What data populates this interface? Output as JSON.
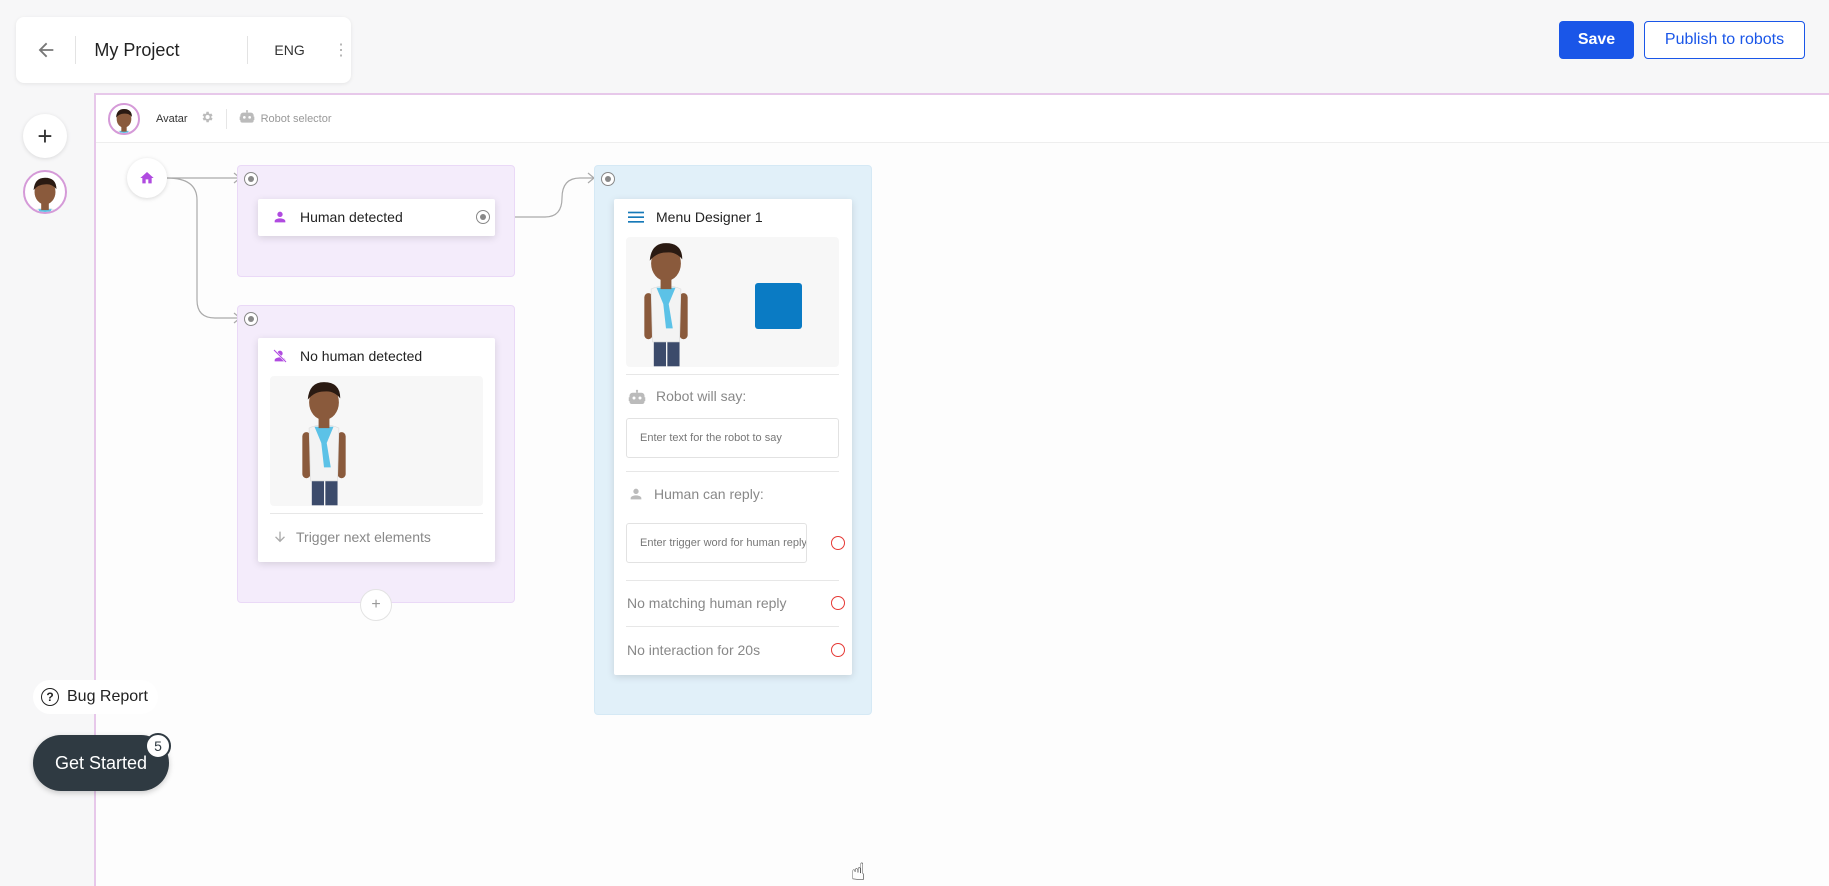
{
  "header": {
    "project_title": "My Project",
    "language": "ENG",
    "save_label": "Save",
    "publish_label": "Publish to robots"
  },
  "canvas_bar": {
    "avatar_label": "Avatar",
    "robot_selector_label": "Robot selector"
  },
  "flow": {
    "human_detected": {
      "title": "Human detected"
    },
    "no_human_detected": {
      "title": "No human detected",
      "trigger_label": "Trigger next elements"
    },
    "menu_designer": {
      "title": "Menu Designer 1",
      "robot_say_label": "Robot will say:",
      "robot_say_placeholder": "Enter text for the robot to say",
      "human_reply_label": "Human can reply:",
      "human_reply_placeholder": "Enter trigger word for human reply",
      "no_match_label": "No matching human reply",
      "no_interaction_label": "No interaction for 20s",
      "screen_color": "#0a7bc4"
    }
  },
  "widgets": {
    "bug_report_label": "Bug Report",
    "get_started_label": "Get Started",
    "get_started_count": "5"
  },
  "colors": {
    "primary": "#1a56e8",
    "accent_purple": "#b04be0",
    "group_purple": "#f4ecfb",
    "group_blue": "#e1f0f9",
    "menu_icon": "#1779b8",
    "warning_red": "#e53935",
    "dark_pill": "#2f3a42"
  },
  "icons": {
    "back": "arrow-left-icon",
    "kebab": "kebab-icon",
    "add": "plus-icon",
    "home": "home-icon",
    "person": "person-icon",
    "person_off": "person-off-icon",
    "menu": "menu-icon",
    "robot": "robot-icon",
    "settings": "gear-icon",
    "arrow_down": "arrow-down-icon",
    "help": "question-circle-icon"
  }
}
